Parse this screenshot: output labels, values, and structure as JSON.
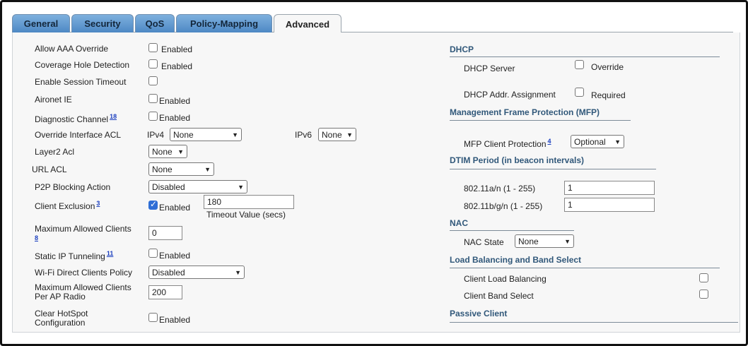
{
  "tabs": [
    "General",
    "Security",
    "QoS",
    "Policy-Mapping",
    "Advanced"
  ],
  "enabled": "Enabled",
  "left": {
    "allow_aaa": "Allow AAA Override",
    "coverage_hole": "Coverage Hole Detection",
    "session_timeout": "Enable Session Timeout",
    "aironet_ie": "Aironet IE",
    "diag_channel": "Diagnostic Channel",
    "diag_channel_ref": "18",
    "override_acl": "Override Interface ACL",
    "ipv4_label": "IPv4",
    "ipv4_value": "None",
    "ipv6_label": "IPv6",
    "ipv6_value": "None",
    "layer2_acl": "Layer2 Acl",
    "layer2_acl_value": "None",
    "url_acl": "URL ACL",
    "url_acl_value": "None",
    "p2p": "P2P Blocking Action",
    "p2p_value": "Disabled",
    "client_exclusion": "Client Exclusion",
    "client_exclusion_ref": "3",
    "timeout_value": "180",
    "timeout_label": "Timeout Value (secs)",
    "max_clients": "Maximum Allowed Clients",
    "max_clients_ref": "8",
    "max_clients_value": "0",
    "static_ip": "Static IP Tunneling",
    "static_ip_ref": "11",
    "wifi_direct": "Wi-Fi Direct Clients Policy",
    "wifi_direct_value": "Disabled",
    "max_per_ap": "Maximum Allowed Clients Per AP Radio",
    "max_per_ap_value": "200",
    "clear_hotspot": "Clear HotSpot Configuration"
  },
  "right": {
    "dhcp": "DHCP",
    "dhcp_server": "DHCP Server",
    "override": "Override",
    "dhcp_assign": "DHCP Addr. Assignment",
    "required": "Required",
    "mfp": "Management Frame Protection (MFP)",
    "mfp_client": "MFP Client Protection",
    "mfp_ref": "4",
    "mfp_value": "Optional",
    "dtim": "DTIM Period (in beacon intervals)",
    "dtim_an": "802.11a/n (1 - 255)",
    "dtim_an_value": "1",
    "dtim_bgn": "802.11b/g/n (1 - 255)",
    "dtim_bgn_value": "1",
    "nac": "NAC",
    "nac_state": "NAC State",
    "nac_value": "None",
    "lb": "Load Balancing and Band Select",
    "client_lb": "Client Load Balancing",
    "client_bs": "Client Band Select",
    "passive": "Passive Client"
  }
}
